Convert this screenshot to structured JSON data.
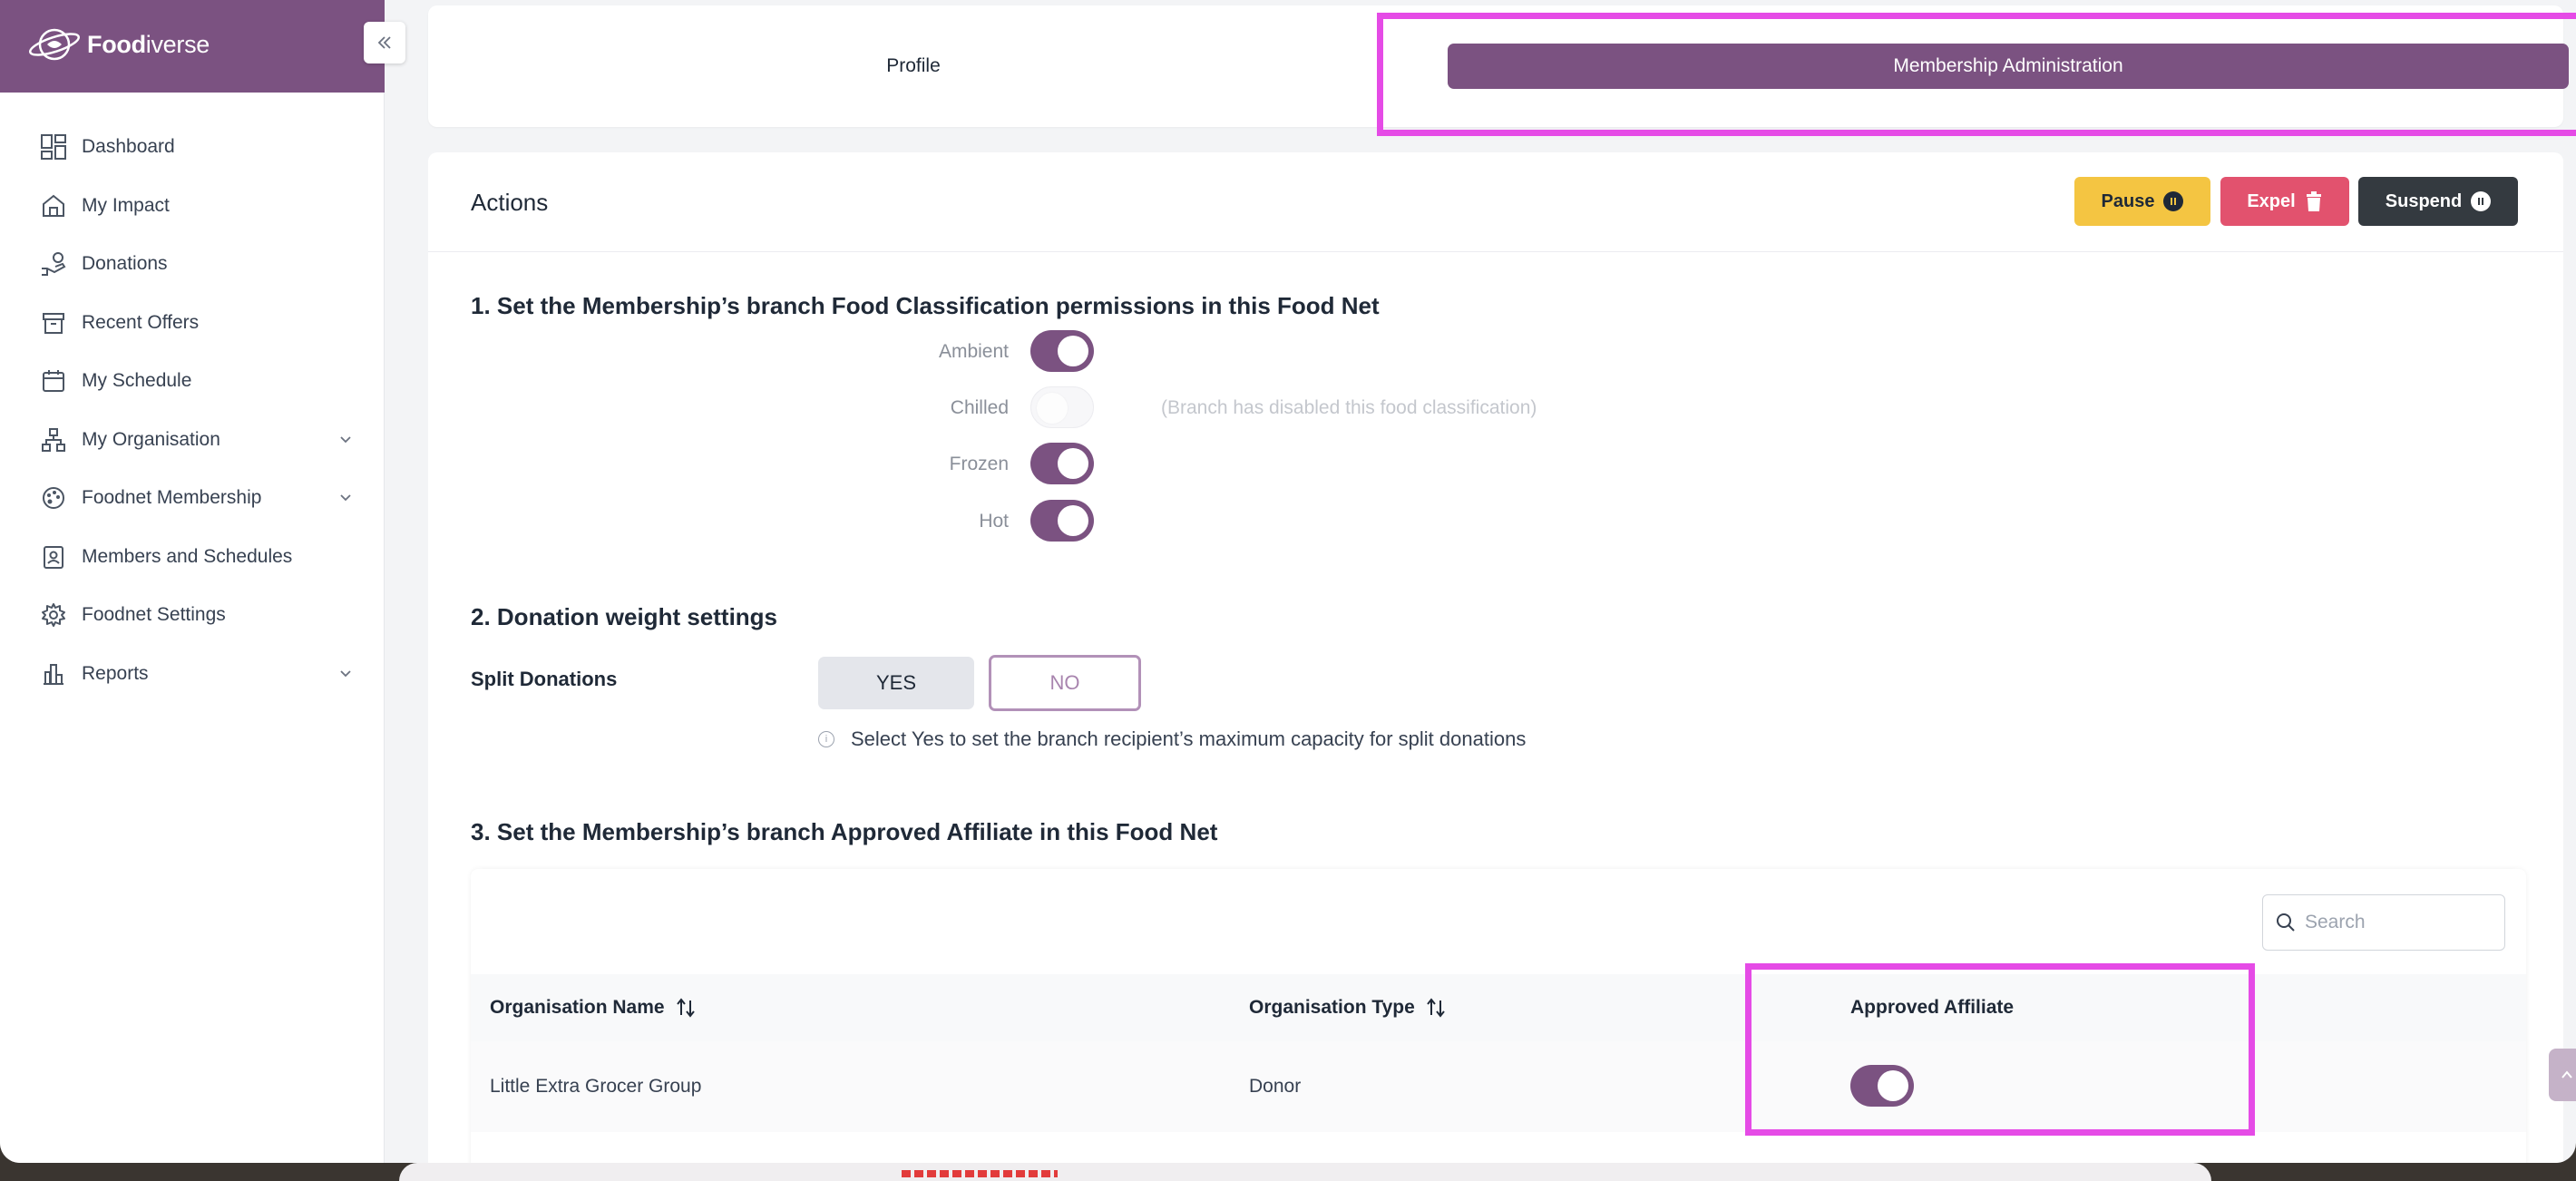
{
  "app": {
    "brand_bold": "Food",
    "brand_rest": "iverse"
  },
  "sidebar": {
    "items": [
      {
        "label": "Dashboard",
        "icon": "dashboard-icon"
      },
      {
        "label": "My Impact",
        "icon": "home-impact-icon"
      },
      {
        "label": "Donations",
        "icon": "hand-donation-icon"
      },
      {
        "label": "Recent Offers",
        "icon": "archive-box-icon"
      },
      {
        "label": "My Schedule",
        "icon": "calendar-icon"
      },
      {
        "label": "My Organisation",
        "icon": "org-chart-icon",
        "expandable": true
      },
      {
        "label": "Foodnet Membership",
        "icon": "palette-membership-icon",
        "expandable": true
      },
      {
        "label": "Members and Schedules",
        "icon": "id-badge-icon"
      },
      {
        "label": "Foodnet Settings",
        "icon": "gear-icon"
      },
      {
        "label": "Reports",
        "icon": "bar-chart-icon",
        "expandable": true
      }
    ]
  },
  "tabs": {
    "profile": "Profile",
    "admin": "Membership Administration"
  },
  "actions": {
    "title": "Actions",
    "pause": "Pause",
    "expel": "Expel",
    "suspend": "Suspend"
  },
  "section1": {
    "title": "1. Set the Membership’s branch Food Classification permissions in this Food Net",
    "items": [
      {
        "label": "Ambient",
        "enabled": true,
        "note": ""
      },
      {
        "label": "Chilled",
        "enabled": false,
        "note": "(Branch has disabled this food classification)"
      },
      {
        "label": "Frozen",
        "enabled": true,
        "note": ""
      },
      {
        "label": "Hot",
        "enabled": true,
        "note": ""
      }
    ]
  },
  "section2": {
    "title": "2. Donation weight settings",
    "split_label": "Split Donations",
    "yes": "YES",
    "no": "NO",
    "hint": "Select Yes to set the branch recipient’s maximum capacity for split donations"
  },
  "section3": {
    "title": "3. Set the Membership’s branch Approved Affiliate in this Food Net",
    "search_placeholder": "Search",
    "columns": {
      "name": "Organisation Name",
      "type": "Organisation Type",
      "approved": "Approved Affiliate"
    },
    "rows": [
      {
        "name": "Little Extra Grocer Group",
        "type": "Donor",
        "approved": true
      }
    ]
  },
  "colors": {
    "brand": "#7b5281",
    "highlight": "#e54be6",
    "pause": "#f4c542",
    "expel": "#e2526e",
    "suspend": "#343a40"
  }
}
